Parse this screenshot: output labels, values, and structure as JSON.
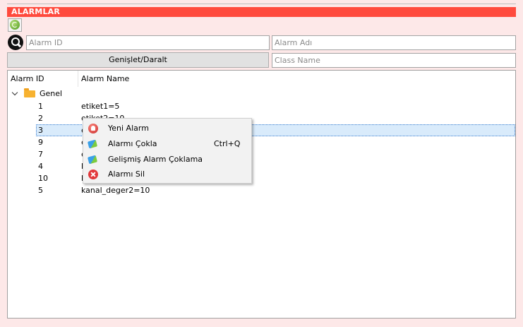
{
  "header": {
    "title": "ALARMLAR"
  },
  "filters": {
    "alarm_id_placeholder": "Alarm ID",
    "alarm_name_placeholder": "Alarm Adı",
    "class_name_placeholder": "Class Name",
    "expand_label": "Genişlet/Daralt"
  },
  "tree": {
    "columns": [
      "Alarm ID",
      "Alarm Name"
    ],
    "group": "Genel",
    "rows": [
      {
        "id": "1",
        "name": "etiket1=5"
      },
      {
        "id": "2",
        "name": "etiket2=10"
      },
      {
        "id": "3",
        "name": "e"
      },
      {
        "id": "9",
        "name": "e"
      },
      {
        "id": "7",
        "name": "e"
      },
      {
        "id": "4",
        "name": "k"
      },
      {
        "id": "10",
        "name": "k"
      },
      {
        "id": "5",
        "name": "kanal_deger2=10"
      }
    ],
    "selected_id": "3"
  },
  "context_menu": {
    "items": [
      {
        "label": "Yeni Alarm",
        "shortcut": "",
        "icon": "new-alarm-icon"
      },
      {
        "label": "Alarmı Çokla",
        "shortcut": "Ctrl+Q",
        "icon": "duplicate-icon"
      },
      {
        "label": "Gelişmiş Alarm Çoklama",
        "shortcut": "",
        "icon": "duplicate-icon"
      },
      {
        "label": "Alarmı Sil",
        "shortcut": "",
        "icon": "delete-icon"
      }
    ]
  },
  "colors": {
    "header_bg": "#ff4a3d",
    "page_bg": "#fde8e8",
    "selection": "#d9ebfb"
  }
}
